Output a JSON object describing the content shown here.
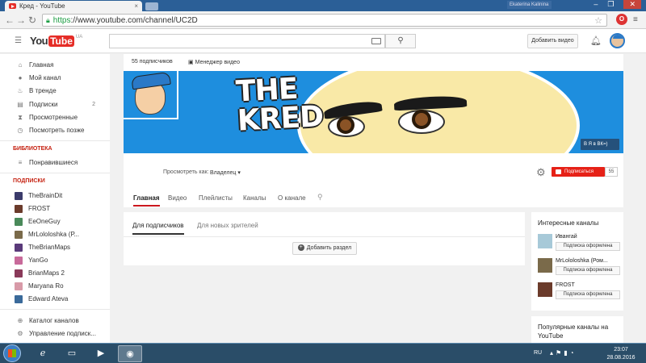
{
  "browser": {
    "tab_title": "Кред - YouTube",
    "tab_close": "×",
    "url_https": "https",
    "url_rest": "://www.youtube.com/channel/UC2D",
    "window_user": "Ekaterina Kalinina",
    "window_controls": [
      "‒",
      "❐",
      "✕"
    ]
  },
  "yt_header": {
    "logo_you": "You",
    "logo_tube": "Tube",
    "logo_region": "UA",
    "search_placeholder": "",
    "upload_label": "Добавить видео"
  },
  "sidebar": {
    "nav": [
      {
        "label": "Главная",
        "icon": "home-icon",
        "glyph": "⌂"
      },
      {
        "label": "Мой канал",
        "icon": "user-icon",
        "glyph": "●"
      },
      {
        "label": "В тренде",
        "icon": "flame-icon",
        "glyph": "♨"
      },
      {
        "label": "Подписки",
        "icon": "subscriptions-icon",
        "glyph": "▤",
        "count": "2"
      },
      {
        "label": "Просмотренные",
        "icon": "hourglass-icon",
        "glyph": "⧗"
      },
      {
        "label": "Посмотреть позже",
        "icon": "clock-icon",
        "glyph": "◷"
      }
    ],
    "library_heading": "БИБЛИОТЕКА",
    "library": [
      {
        "label": "Понравившиеся",
        "icon": "playlist-icon",
        "glyph": "≡"
      }
    ],
    "subs_heading": "ПОДПИСКИ",
    "subscriptions": [
      {
        "label": "TheBrainDit",
        "color": "#3b3b6b"
      },
      {
        "label": "FROST",
        "color": "#6b3b2b"
      },
      {
        "label": "EeOneGuy",
        "color": "#4a8a5a"
      },
      {
        "label": "MrLololoshka (Р...",
        "color": "#7a6a4a"
      },
      {
        "label": "TheBrianMaps",
        "color": "#5a3a7a"
      },
      {
        "label": "YanGo",
        "color": "#c86a9a"
      },
      {
        "label": "BrianMaps 2",
        "color": "#8a3a5a"
      },
      {
        "label": "Maryana Ro",
        "color": "#d89aa8"
      },
      {
        "label": "Edward Ateva",
        "color": "#3a6a9a"
      }
    ],
    "bottom": [
      {
        "label": "Каталог каналов",
        "icon": "catalog-icon",
        "glyph": "⊕"
      },
      {
        "label": "Управление подписк...",
        "icon": "settings-icon",
        "glyph": "⚙"
      }
    ]
  },
  "channel": {
    "subscribers": "55 подписчиков",
    "video_manager": "Менеджер видео",
    "banner_title": "THE KRED",
    "vk_link": "Я в ВК=)",
    "view_as_label": "Просмотреть как:",
    "view_as_value": "Владелец ▾",
    "subscribe_label": "Подписаться",
    "subscribe_count": "55",
    "tabs": [
      "Главная",
      "Видео",
      "Плейлисты",
      "Каналы",
      "О канале"
    ],
    "subtabs": [
      "Для подписчиков",
      "Для новых зрителей"
    ],
    "add_section": "Добавить раздел"
  },
  "interesting": {
    "heading": "Интересные каналы",
    "channels": [
      {
        "name": "Ивангай",
        "button": "Подписка оформлена",
        "color": "#a7c9d8"
      },
      {
        "name": "MrLololoshka (Ром...",
        "button": "Подписка оформлена",
        "color": "#7a6a4a"
      },
      {
        "name": "FROST",
        "button": "Подписка оформлена",
        "color": "#6b3b2b"
      }
    ]
  },
  "popular": {
    "heading": "Популярные каналы на YouTube"
  },
  "taskbar": {
    "lang": "RU",
    "time": "23:07",
    "date": "28.08.2016"
  },
  "colors": {
    "accent_red": "#e62117",
    "banner_blue": "#1e8ede",
    "heading_red": "#c5200f"
  }
}
